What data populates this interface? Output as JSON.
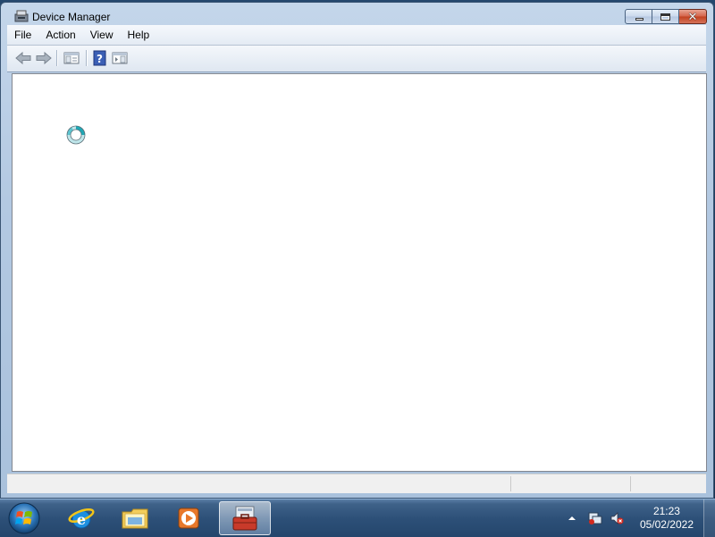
{
  "window": {
    "title": "Device Manager",
    "icon": "device-manager-icon",
    "caption_buttons": [
      "minimize-icon",
      "maximize-icon",
      "close-icon"
    ]
  },
  "menu": {
    "items": [
      {
        "label": "File"
      },
      {
        "label": "Action"
      },
      {
        "label": "View"
      },
      {
        "label": "Help"
      }
    ]
  },
  "toolbar": {
    "buttons": [
      "back-arrow-icon",
      "forward-arrow-icon",
      "show-hide-console-tree-icon",
      "help-icon",
      "show-hide-action-pane-icon"
    ]
  },
  "content": {
    "cursor": "busy-cursor"
  },
  "taskbar": {
    "start": "start-orb-icon",
    "pinned": [
      "internet-explorer-icon",
      "windows-explorer-icon",
      "media-player-icon",
      "device-manager-task-icon"
    ],
    "active": "device-manager-task-icon"
  },
  "tray": {
    "icons": [
      "show-hidden-icons-arrow",
      "network-icon",
      "volume-muted-icon"
    ],
    "time": "21:23",
    "date": "05/02/2022"
  },
  "colors": {
    "taskbar": "#2d5078",
    "window_frame": "#b3c9e2",
    "close_button": "#c2411f"
  }
}
